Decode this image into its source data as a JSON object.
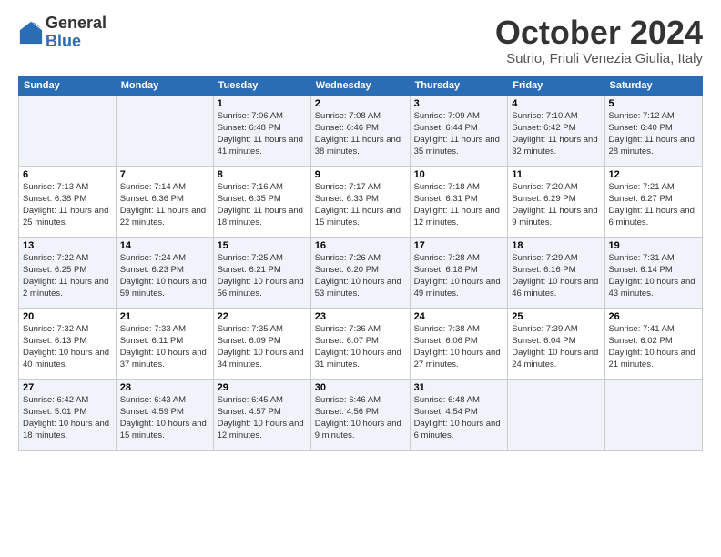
{
  "logo": {
    "general": "General",
    "blue": "Blue"
  },
  "title": "October 2024",
  "location": "Sutrio, Friuli Venezia Giulia, Italy",
  "days_of_week": [
    "Sunday",
    "Monday",
    "Tuesday",
    "Wednesday",
    "Thursday",
    "Friday",
    "Saturday"
  ],
  "weeks": [
    [
      {
        "day": "",
        "info": ""
      },
      {
        "day": "",
        "info": ""
      },
      {
        "day": "1",
        "info": "Sunrise: 7:06 AM\nSunset: 6:48 PM\nDaylight: 11 hours and 41 minutes."
      },
      {
        "day": "2",
        "info": "Sunrise: 7:08 AM\nSunset: 6:46 PM\nDaylight: 11 hours and 38 minutes."
      },
      {
        "day": "3",
        "info": "Sunrise: 7:09 AM\nSunset: 6:44 PM\nDaylight: 11 hours and 35 minutes."
      },
      {
        "day": "4",
        "info": "Sunrise: 7:10 AM\nSunset: 6:42 PM\nDaylight: 11 hours and 32 minutes."
      },
      {
        "day": "5",
        "info": "Sunrise: 7:12 AM\nSunset: 6:40 PM\nDaylight: 11 hours and 28 minutes."
      }
    ],
    [
      {
        "day": "6",
        "info": "Sunrise: 7:13 AM\nSunset: 6:38 PM\nDaylight: 11 hours and 25 minutes."
      },
      {
        "day": "7",
        "info": "Sunrise: 7:14 AM\nSunset: 6:36 PM\nDaylight: 11 hours and 22 minutes."
      },
      {
        "day": "8",
        "info": "Sunrise: 7:16 AM\nSunset: 6:35 PM\nDaylight: 11 hours and 18 minutes."
      },
      {
        "day": "9",
        "info": "Sunrise: 7:17 AM\nSunset: 6:33 PM\nDaylight: 11 hours and 15 minutes."
      },
      {
        "day": "10",
        "info": "Sunrise: 7:18 AM\nSunset: 6:31 PM\nDaylight: 11 hours and 12 minutes."
      },
      {
        "day": "11",
        "info": "Sunrise: 7:20 AM\nSunset: 6:29 PM\nDaylight: 11 hours and 9 minutes."
      },
      {
        "day": "12",
        "info": "Sunrise: 7:21 AM\nSunset: 6:27 PM\nDaylight: 11 hours and 6 minutes."
      }
    ],
    [
      {
        "day": "13",
        "info": "Sunrise: 7:22 AM\nSunset: 6:25 PM\nDaylight: 11 hours and 2 minutes."
      },
      {
        "day": "14",
        "info": "Sunrise: 7:24 AM\nSunset: 6:23 PM\nDaylight: 10 hours and 59 minutes."
      },
      {
        "day": "15",
        "info": "Sunrise: 7:25 AM\nSunset: 6:21 PM\nDaylight: 10 hours and 56 minutes."
      },
      {
        "day": "16",
        "info": "Sunrise: 7:26 AM\nSunset: 6:20 PM\nDaylight: 10 hours and 53 minutes."
      },
      {
        "day": "17",
        "info": "Sunrise: 7:28 AM\nSunset: 6:18 PM\nDaylight: 10 hours and 49 minutes."
      },
      {
        "day": "18",
        "info": "Sunrise: 7:29 AM\nSunset: 6:16 PM\nDaylight: 10 hours and 46 minutes."
      },
      {
        "day": "19",
        "info": "Sunrise: 7:31 AM\nSunset: 6:14 PM\nDaylight: 10 hours and 43 minutes."
      }
    ],
    [
      {
        "day": "20",
        "info": "Sunrise: 7:32 AM\nSunset: 6:13 PM\nDaylight: 10 hours and 40 minutes."
      },
      {
        "day": "21",
        "info": "Sunrise: 7:33 AM\nSunset: 6:11 PM\nDaylight: 10 hours and 37 minutes."
      },
      {
        "day": "22",
        "info": "Sunrise: 7:35 AM\nSunset: 6:09 PM\nDaylight: 10 hours and 34 minutes."
      },
      {
        "day": "23",
        "info": "Sunrise: 7:36 AM\nSunset: 6:07 PM\nDaylight: 10 hours and 31 minutes."
      },
      {
        "day": "24",
        "info": "Sunrise: 7:38 AM\nSunset: 6:06 PM\nDaylight: 10 hours and 27 minutes."
      },
      {
        "day": "25",
        "info": "Sunrise: 7:39 AM\nSunset: 6:04 PM\nDaylight: 10 hours and 24 minutes."
      },
      {
        "day": "26",
        "info": "Sunrise: 7:41 AM\nSunset: 6:02 PM\nDaylight: 10 hours and 21 minutes."
      }
    ],
    [
      {
        "day": "27",
        "info": "Sunrise: 6:42 AM\nSunset: 5:01 PM\nDaylight: 10 hours and 18 minutes."
      },
      {
        "day": "28",
        "info": "Sunrise: 6:43 AM\nSunset: 4:59 PM\nDaylight: 10 hours and 15 minutes."
      },
      {
        "day": "29",
        "info": "Sunrise: 6:45 AM\nSunset: 4:57 PM\nDaylight: 10 hours and 12 minutes."
      },
      {
        "day": "30",
        "info": "Sunrise: 6:46 AM\nSunset: 4:56 PM\nDaylight: 10 hours and 9 minutes."
      },
      {
        "day": "31",
        "info": "Sunrise: 6:48 AM\nSunset: 4:54 PM\nDaylight: 10 hours and 6 minutes."
      },
      {
        "day": "",
        "info": ""
      },
      {
        "day": "",
        "info": ""
      }
    ]
  ]
}
